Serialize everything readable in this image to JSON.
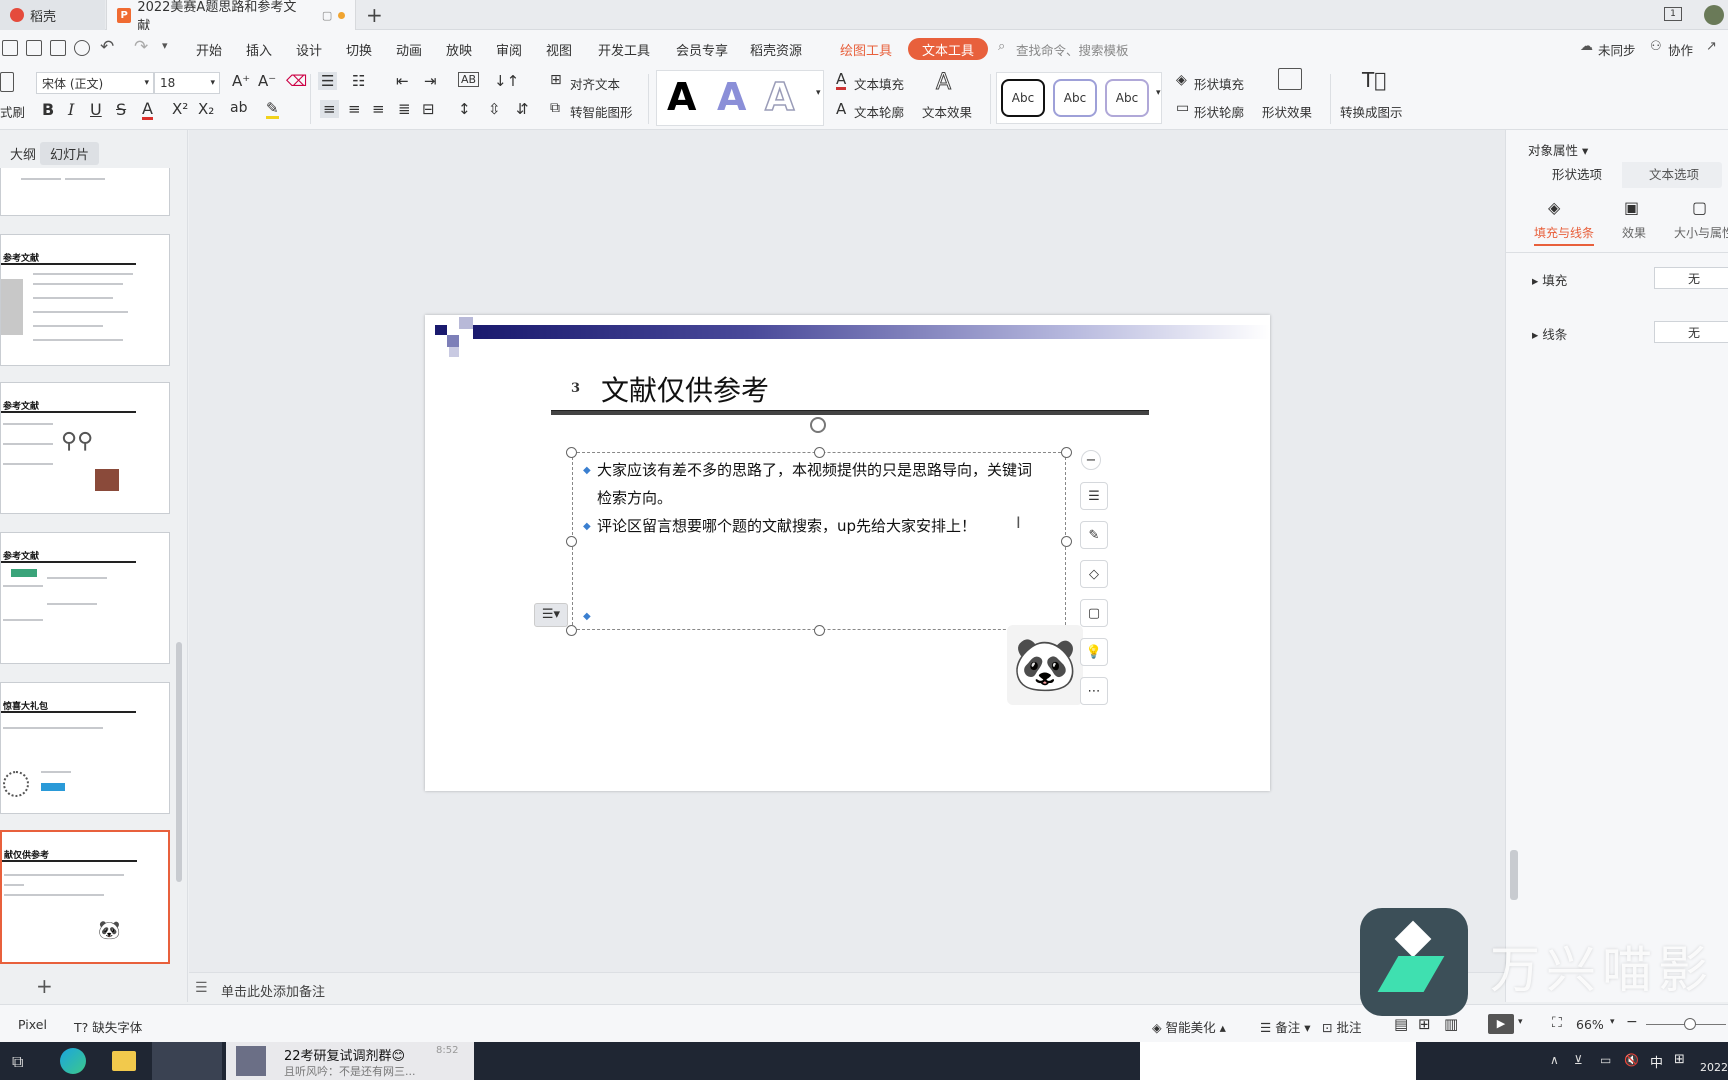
{
  "titlebar": {
    "tabs": [
      {
        "label": "稻壳",
        "active": false
      },
      {
        "label": "2022美赛A题思路和参考文献",
        "active": true
      }
    ],
    "new_tab": "+",
    "page_indicator": "1"
  },
  "menubar": {
    "items": [
      "开始",
      "插入",
      "设计",
      "切换",
      "动画",
      "放映",
      "审阅",
      "视图",
      "开发工具",
      "会员专享",
      "稻壳资源",
      "绘图工具"
    ],
    "active_tool": "文本工具",
    "search_placeholder": "查找命令、搜索模板",
    "right": {
      "sync": "未同步",
      "collab": "协作"
    }
  },
  "ribbon": {
    "brush_label": "式刷",
    "font_name": "宋体 (正文)",
    "font_size": "18",
    "align_text": "对齐文本",
    "smartart": "转智能图形",
    "text_fill": "文本填充",
    "text_outline": "文本轮廓",
    "text_effect": "文本效果",
    "abc_samples": [
      "Abc",
      "Abc",
      "Abc"
    ],
    "shape_fill": "形状填充",
    "shape_outline": "形状轮廓",
    "shape_effect": "形状效果",
    "convert": "转换成图示",
    "big_a": "A"
  },
  "leftpanel": {
    "tab_outline": "大纲",
    "tab_slides": "幻灯片",
    "thumbs": [
      {
        "title": ""
      },
      {
        "title": "参考文献"
      },
      {
        "title": "参考文献"
      },
      {
        "title": "参考文献"
      },
      {
        "title": "惊喜大礼包"
      },
      {
        "title": "献仅供参考"
      }
    ],
    "add": "+"
  },
  "slide": {
    "number": "3",
    "title": "文献仅供参考",
    "bullets": [
      "大家应该有差不多的思路了，本视频提供的只是思路导向，关键词",
      "检索方向。",
      "评论区留言想要哪个题的文献搜索，up先给大家安排上！"
    ]
  },
  "notes": {
    "placeholder": "单击此处添加备注"
  },
  "rightpanel": {
    "header": "对象属性",
    "tabs": [
      "形状选项",
      "文本选项"
    ],
    "subtabs": [
      "填充与线条",
      "效果",
      "大小与属性"
    ],
    "rows": [
      {
        "label": "填充",
        "value": "无"
      },
      {
        "label": "线条",
        "value": "无"
      }
    ]
  },
  "statusbar": {
    "left": [
      "Pixel",
      "缺失字体"
    ],
    "smart": "智能美化",
    "notes": "备注",
    "comments": "批注",
    "zoom": "66%"
  },
  "taskbar": {
    "notif_title": "22考研复试调剂群😊",
    "notif_sub": "且听风吟：不是还有网三...",
    "notif_time": "8:52",
    "ime": "中",
    "date": "2022"
  },
  "watermark": {
    "text": "万兴喵影"
  },
  "colors": {
    "accent": "#e8603c",
    "slide_bar_dark": "#1a1a6e",
    "slide_bar_light": "#b7b9de"
  }
}
